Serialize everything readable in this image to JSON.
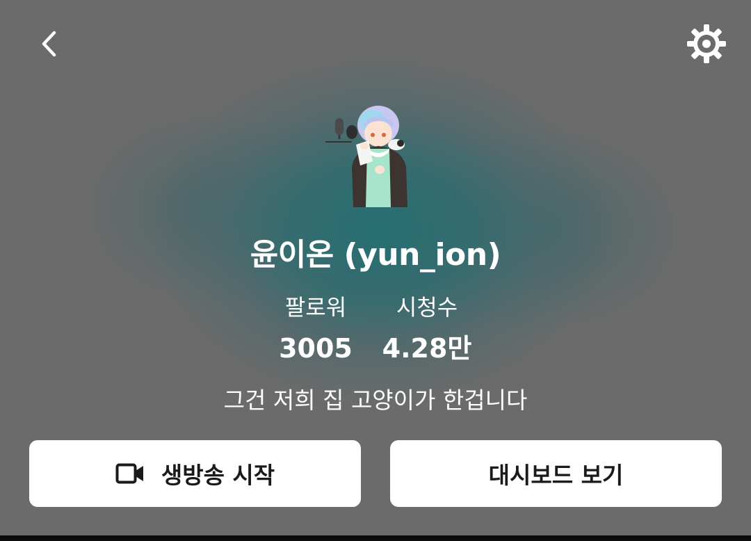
{
  "header": {
    "back_icon": "chevron-left-icon",
    "settings_icon": "gear-icon"
  },
  "profile": {
    "avatar_icon": "avatar",
    "name": "윤이온 (yun_ion)",
    "bio": "그건 저희 집 고양이가 한겁니다"
  },
  "stats": {
    "followers_label": "팔로워",
    "followers_value": "3005",
    "views_label": "시청수",
    "views_value": "4.28만"
  },
  "actions": {
    "start_live_label": "생방송 시작",
    "start_live_icon": "video-camera-icon",
    "dashboard_label": "대시보드 보기"
  },
  "colors": {
    "background": "#6b6b6b",
    "accent_teal": "#226e72",
    "button_bg": "#ffffff",
    "button_text": "#1a1a1a"
  }
}
